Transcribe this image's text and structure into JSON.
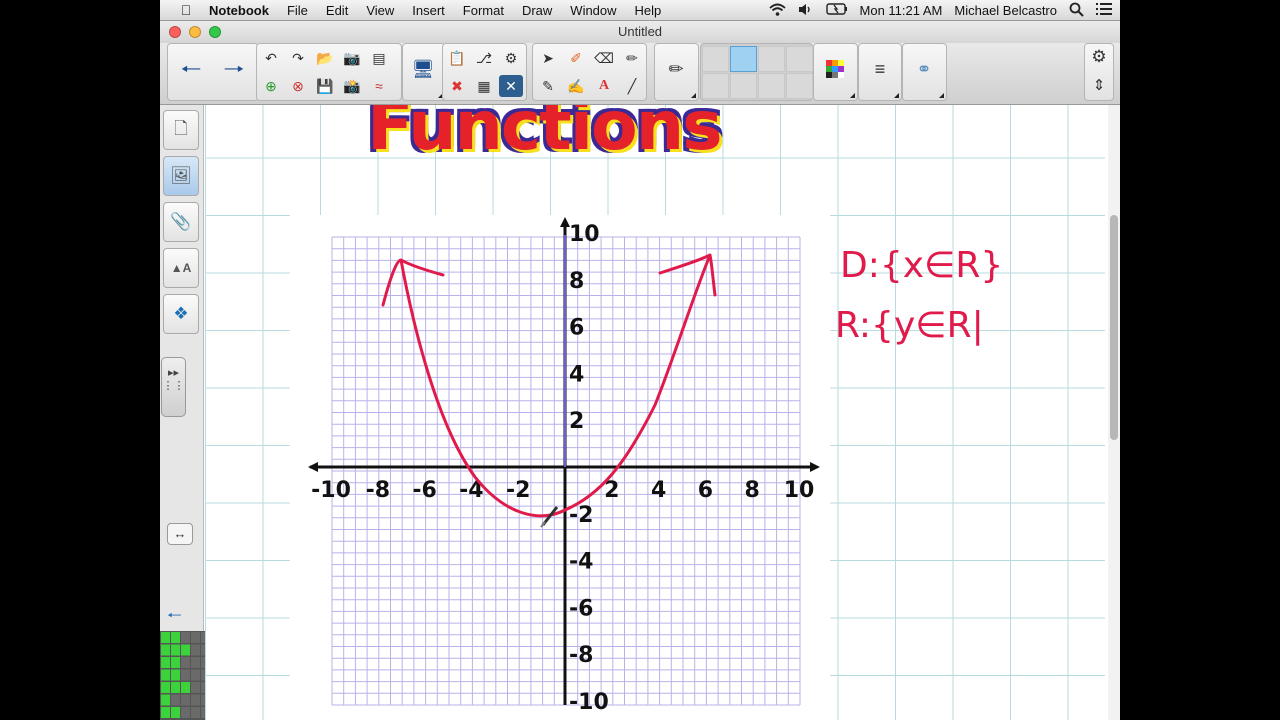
{
  "menubar": {
    "apple": "",
    "items": [
      "Notebook",
      "File",
      "Edit",
      "View",
      "Insert",
      "Format",
      "Draw",
      "Window",
      "Help"
    ],
    "clock": "Mon 11:21 AM",
    "user": "Michael Belcastro"
  },
  "window": {
    "title": "Untitled"
  },
  "canvas": {
    "heading": "Functions",
    "domain_note": "D:{x∈R}",
    "range_note": "R:{y∈R|",
    "graph": {
      "x_ticks": [
        "-10",
        "-8",
        "-6",
        "-4",
        "-2",
        "2",
        "4",
        "6",
        "8",
        "10"
      ],
      "y_ticks": [
        "10",
        "8",
        "6",
        "4",
        "2",
        "-2",
        "-4",
        "-6",
        "-8",
        "-10"
      ]
    }
  },
  "colors": {
    "ink": "#e01a4a",
    "grid": "#b9b2ea",
    "page_grid": "#b8dbe2"
  }
}
